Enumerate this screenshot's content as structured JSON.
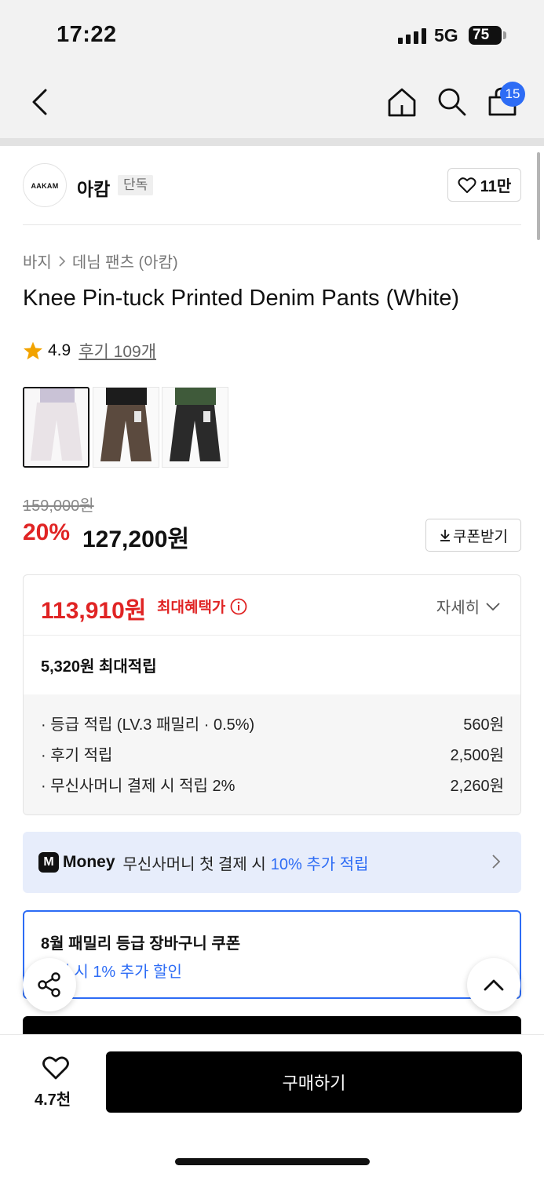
{
  "status_bar": {
    "time": "17:22",
    "network": "5G",
    "battery": "75"
  },
  "nav": {
    "cart_badge": "15",
    "icons": [
      "back-arrow-icon",
      "home-icon",
      "search-icon",
      "cart-icon"
    ]
  },
  "brand": {
    "logo_text": "AAKAM",
    "name": "아캄",
    "badge": "단독",
    "likes": "11만"
  },
  "breadcrumb": [
    "바지",
    "데님 팬츠 (아캄)"
  ],
  "product": {
    "title": "Knee Pin-tuck Printed Denim Pants (White)",
    "rating": "4.9",
    "review_link": "후기 109개"
  },
  "thumbnails": [
    {
      "name": "white",
      "color": "#e8e2e6"
    },
    {
      "name": "brown",
      "color": "#5b4a3e"
    },
    {
      "name": "black",
      "color": "#2a2a2a"
    }
  ],
  "price": {
    "original": "159,000원",
    "discount": "20%",
    "sale": "127,200원",
    "coupon_label": "쿠폰받기"
  },
  "benefits": {
    "max_price": "113,910원",
    "max_label": "최대혜택가",
    "detail_label": "자세히",
    "points_total": "5,320원 최대적립",
    "rows": [
      {
        "label": "· 등급 적립 (LV.3 패밀리 · 0.5%)",
        "value": "560원"
      },
      {
        "label": "· 후기 적립",
        "value": "2,500원"
      },
      {
        "label": "· 무신사머니 결제 시 적립 2%",
        "value": "2,260원"
      }
    ]
  },
  "money_banner": {
    "logo": "M",
    "brand": "Money",
    "text": "무신사머니 첫 결제 시",
    "highlight": "10% 추가 적립"
  },
  "family_coupon": {
    "title": "8월 패밀리 등급 장바구니 쿠폰",
    "subtitle": "결제 시 1% 추가 할인"
  },
  "bottom": {
    "wish_count": "4.7천",
    "buy_label": "구매하기"
  },
  "colors": {
    "accent_red": "#e02424",
    "accent_blue": "#2d6cf5"
  }
}
